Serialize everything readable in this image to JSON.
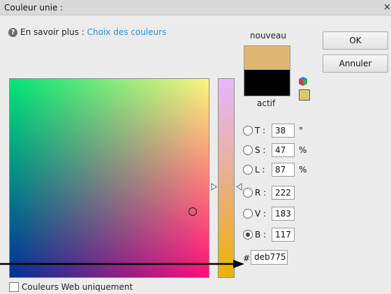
{
  "dialog": {
    "title": "Couleur unie :",
    "close_glyph": "×"
  },
  "help": {
    "icon": "help-icon",
    "label": "En savoir plus : ",
    "link": "Choix des couleurs"
  },
  "swatches": {
    "new_label": "nouveau",
    "current_label": "actif",
    "new_color": "#deb775",
    "current_color": "#000000",
    "websafe_color": "#d9c96a",
    "gamut_icon": "color-cube-icon"
  },
  "buttons": {
    "ok": "OK",
    "cancel": "Annuler"
  },
  "fields": [
    {
      "key": "T",
      "label": "T :",
      "value": "38",
      "unit": "°",
      "checked": false
    },
    {
      "key": "S",
      "label": "S :",
      "value": "47",
      "unit": "%",
      "checked": false
    },
    {
      "key": "L",
      "label": "L :",
      "value": "87",
      "unit": "%",
      "checked": false
    },
    {
      "key": "R",
      "label": "R :",
      "value": "222",
      "unit": "",
      "checked": false
    },
    {
      "key": "V",
      "label": "V :",
      "value": "183",
      "unit": "",
      "checked": false
    },
    {
      "key": "B",
      "label": "B :",
      "value": "117",
      "unit": "",
      "checked": true
    }
  ],
  "hex": {
    "prefix": "#",
    "value": "deb775"
  },
  "web_only": {
    "label": "Couleurs Web uniquement",
    "checked": false
  },
  "colors": {
    "accent_link": "#2b8fd6",
    "annotation_arrow": "#000000"
  }
}
